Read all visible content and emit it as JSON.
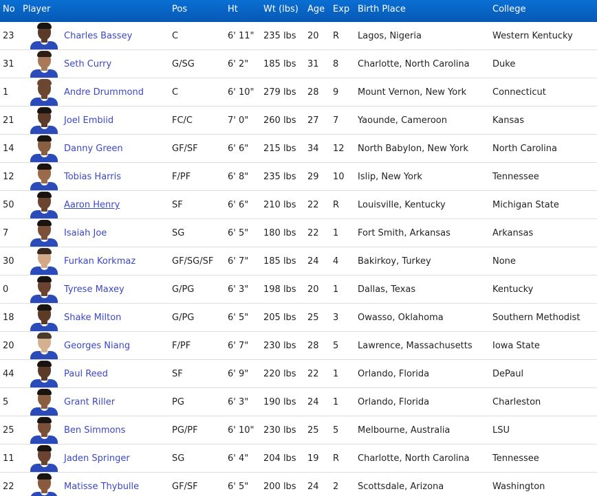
{
  "colors": {
    "header_bg": "#0758b4",
    "header_text": "#ffffff",
    "player_link": "#3b47c4",
    "row_border": "#dcdcdc",
    "jersey": "#2a4bb8"
  },
  "columns": {
    "no": "No",
    "player": "Player",
    "pos": "Pos",
    "ht": "Ht",
    "wt": "Wt (lbs)",
    "age": "Age",
    "exp": "Exp",
    "birth": "Birth Place",
    "college": "College"
  },
  "players": [
    {
      "no": "23",
      "name": "Charles Bassey",
      "pos": "C",
      "ht": "6' 11\"",
      "wt": "235 lbs",
      "age": "20",
      "exp": "R",
      "birth": "Lagos, Nigeria",
      "college": "Western Kentucky",
      "skin": "#5a3a28",
      "hair": "#1a1410"
    },
    {
      "no": "31",
      "name": "Seth Curry",
      "pos": "G/SG",
      "ht": "6' 2\"",
      "wt": "185 lbs",
      "age": "31",
      "exp": "8",
      "birth": "Charlotte, North Carolina",
      "college": "Duke",
      "skin": "#a87a5a",
      "hair": "#2a1e16"
    },
    {
      "no": "1",
      "name": "Andre Drummond",
      "pos": "C",
      "ht": "6' 10\"",
      "wt": "279 lbs",
      "age": "28",
      "exp": "9",
      "birth": "Mount Vernon, New York",
      "college": "Connecticut",
      "skin": "#6b4630",
      "hair": "#6b4630"
    },
    {
      "no": "21",
      "name": "Joel Embiid",
      "pos": "FC/C",
      "ht": "7' 0\"",
      "wt": "260 lbs",
      "age": "27",
      "exp": "7",
      "birth": "Yaounde, Cameroon",
      "college": "Kansas",
      "skin": "#5c3b29",
      "hair": "#1a1410"
    },
    {
      "no": "14",
      "name": "Danny Green",
      "pos": "GF/SF",
      "ht": "6' 6\"",
      "wt": "215 lbs",
      "age": "34",
      "exp": "12",
      "birth": "North Babylon, New York",
      "college": "North Carolina",
      "skin": "#8a5e40",
      "hair": "#1a1410"
    },
    {
      "no": "12",
      "name": "Tobias Harris",
      "pos": "F/PF",
      "ht": "6' 8\"",
      "wt": "235 lbs",
      "age": "29",
      "exp": "10",
      "birth": "Islip, New York",
      "college": "Tennessee",
      "skin": "#9a6a4a",
      "hair": "#1a1410"
    },
    {
      "no": "50",
      "name": "Aaron Henry",
      "pos": "SF",
      "ht": "6' 6\"",
      "wt": "210 lbs",
      "age": "22",
      "exp": "R",
      "birth": "Louisville, Kentucky",
      "college": "Michigan State",
      "skin": "#6a4430",
      "hair": "#1a1410"
    },
    {
      "no": "7",
      "name": "Isaiah Joe",
      "pos": "SG",
      "ht": "6' 5\"",
      "wt": "180 lbs",
      "age": "22",
      "exp": "1",
      "birth": "Fort Smith, Arkansas",
      "college": "Arkansas",
      "skin": "#7a5038",
      "hair": "#1a1410"
    },
    {
      "no": "30",
      "name": "Furkan Korkmaz",
      "pos": "GF/SG/SF",
      "ht": "6' 7\"",
      "wt": "185 lbs",
      "age": "24",
      "exp": "4",
      "birth": "Bakirkoy, Turkey",
      "college": "None",
      "skin": "#d2a888",
      "hair": "#3a2a1e"
    },
    {
      "no": "0",
      "name": "Tyrese Maxey",
      "pos": "G/PG",
      "ht": "6' 3\"",
      "wt": "198 lbs",
      "age": "20",
      "exp": "1",
      "birth": "Dallas, Texas",
      "college": "Kentucky",
      "skin": "#6a4430",
      "hair": "#1a1410"
    },
    {
      "no": "18",
      "name": "Shake Milton",
      "pos": "G/PG",
      "ht": "6' 5\"",
      "wt": "205 lbs",
      "age": "25",
      "exp": "3",
      "birth": "Owasso, Oklahoma",
      "college": "Southern Methodist",
      "skin": "#5c3b29",
      "hair": "#1a1410"
    },
    {
      "no": "20",
      "name": "Georges Niang",
      "pos": "F/PF",
      "ht": "6' 7\"",
      "wt": "230 lbs",
      "age": "28",
      "exp": "5",
      "birth": "Lawrence, Massachusetts",
      "college": "Iowa State",
      "skin": "#d4b090",
      "hair": "#4a3a2a"
    },
    {
      "no": "44",
      "name": "Paul Reed",
      "pos": "SF",
      "ht": "6' 9\"",
      "wt": "220 lbs",
      "age": "22",
      "exp": "1",
      "birth": "Orlando, Florida",
      "college": "DePaul",
      "skin": "#5a3a28",
      "hair": "#1a1410"
    },
    {
      "no": "5",
      "name": "Grant Riller",
      "pos": "PG",
      "ht": "6' 3\"",
      "wt": "190 lbs",
      "age": "24",
      "exp": "1",
      "birth": "Orlando, Florida",
      "college": "Charleston",
      "skin": "#8a5e40",
      "hair": "#1a1410"
    },
    {
      "no": "25",
      "name": "Ben Simmons",
      "pos": "PG/PF",
      "ht": "6' 10\"",
      "wt": "230 lbs",
      "age": "25",
      "exp": "5",
      "birth": "Melbourne, Australia",
      "college": "LSU",
      "skin": "#7a5038",
      "hair": "#1a1410"
    },
    {
      "no": "11",
      "name": "Jaden Springer",
      "pos": "SG",
      "ht": "6' 4\"",
      "wt": "204 lbs",
      "age": "19",
      "exp": "R",
      "birth": "Charlotte, North Carolina",
      "college": "Tennessee",
      "skin": "#6a4430",
      "hair": "#1a1410"
    },
    {
      "no": "22",
      "name": "Matisse Thybulle",
      "pos": "GF/SF",
      "ht": "6' 5\"",
      "wt": "200 lbs",
      "age": "24",
      "exp": "2",
      "birth": "Scottsdale, Arizona",
      "college": "Washington",
      "skin": "#8a5a3e",
      "hair": "#1a1410"
    }
  ],
  "hovered_player_index": 6
}
